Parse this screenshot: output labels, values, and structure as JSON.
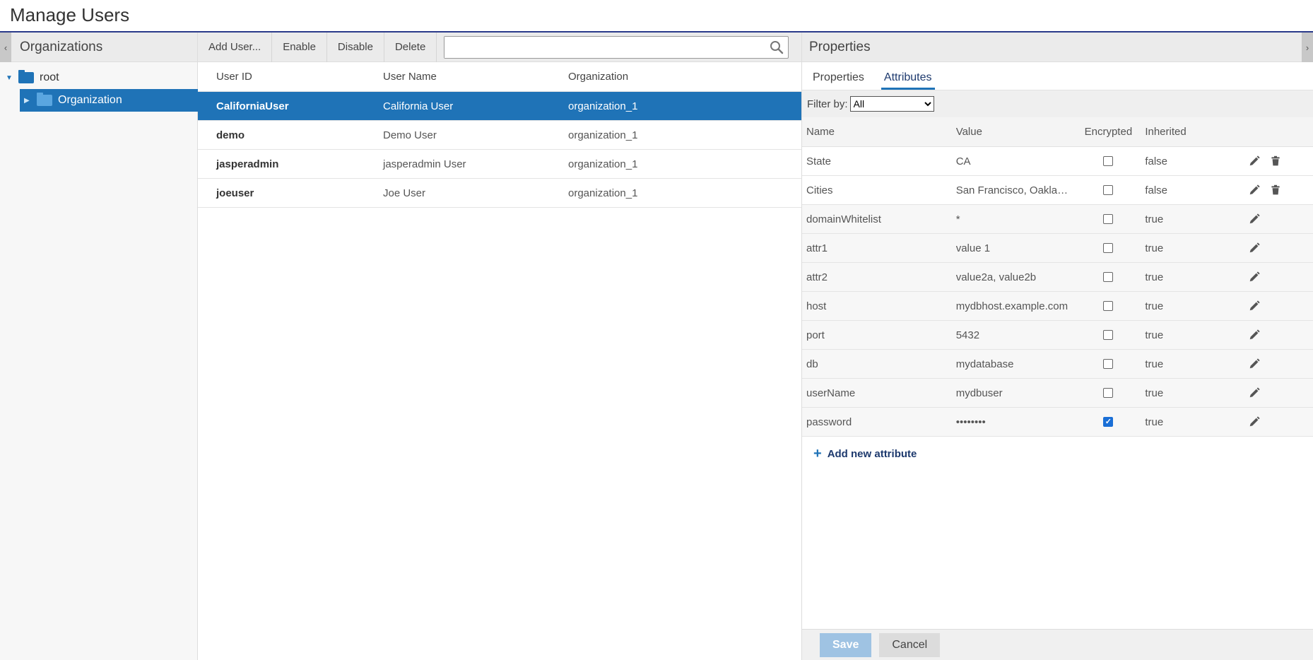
{
  "page": {
    "title": "Manage Users"
  },
  "left_panel": {
    "title": "Organizations",
    "tree": [
      {
        "label": "root",
        "expanded": true
      },
      {
        "label": "Organization",
        "selected": true,
        "expanded": false
      }
    ]
  },
  "middle_panel": {
    "toolbar": {
      "add_user": "Add User...",
      "enable": "Enable",
      "disable": "Disable",
      "delete": "Delete",
      "search_value": ""
    },
    "columns": [
      "User ID",
      "User Name",
      "Organization"
    ],
    "users": [
      {
        "id": "CaliforniaUser",
        "name": "California User",
        "org": "organization_1",
        "selected": true
      },
      {
        "id": "demo",
        "name": "Demo User",
        "org": "organization_1",
        "selected": false
      },
      {
        "id": "jasperadmin",
        "name": "jasperadmin User",
        "org": "organization_1",
        "selected": false
      },
      {
        "id": "joeuser",
        "name": "Joe User",
        "org": "organization_1",
        "selected": false
      }
    ]
  },
  "right_panel": {
    "title": "Properties",
    "tabs": [
      {
        "label": "Properties",
        "active": false
      },
      {
        "label": "Attributes",
        "active": true
      }
    ],
    "filter": {
      "label": "Filter by:",
      "selected": "All"
    },
    "columns": [
      "Name",
      "Value",
      "Encrypted",
      "Inherited"
    ],
    "attributes": [
      {
        "name": "State",
        "value": "CA",
        "encrypted": false,
        "inherited": "false"
      },
      {
        "name": "Cities",
        "value": "San Francisco, Oakland, San Jose",
        "encrypted": false,
        "inherited": "false"
      },
      {
        "name": "domainWhitelist",
        "value": "*",
        "encrypted": false,
        "inherited": "true"
      },
      {
        "name": "attr1",
        "value": "value 1",
        "encrypted": false,
        "inherited": "true"
      },
      {
        "name": "attr2",
        "value": "value2a, value2b",
        "encrypted": false,
        "inherited": "true"
      },
      {
        "name": "host",
        "value": "mydbhost.example.com",
        "encrypted": false,
        "inherited": "true"
      },
      {
        "name": "port",
        "value": "5432",
        "encrypted": false,
        "inherited": "true"
      },
      {
        "name": "db",
        "value": "mydatabase",
        "encrypted": false,
        "inherited": "true"
      },
      {
        "name": "userName",
        "value": "mydbuser",
        "encrypted": false,
        "inherited": "true"
      },
      {
        "name": "password",
        "value": "••••••••",
        "encrypted": true,
        "inherited": "true"
      }
    ],
    "add_attribute": "Add new attribute",
    "footer": {
      "save": "Save",
      "cancel": "Cancel"
    }
  },
  "colors": {
    "accent": "#1f73b7",
    "title_rule": "#2a3a8a",
    "save_disabled": "#9fc3e3"
  }
}
